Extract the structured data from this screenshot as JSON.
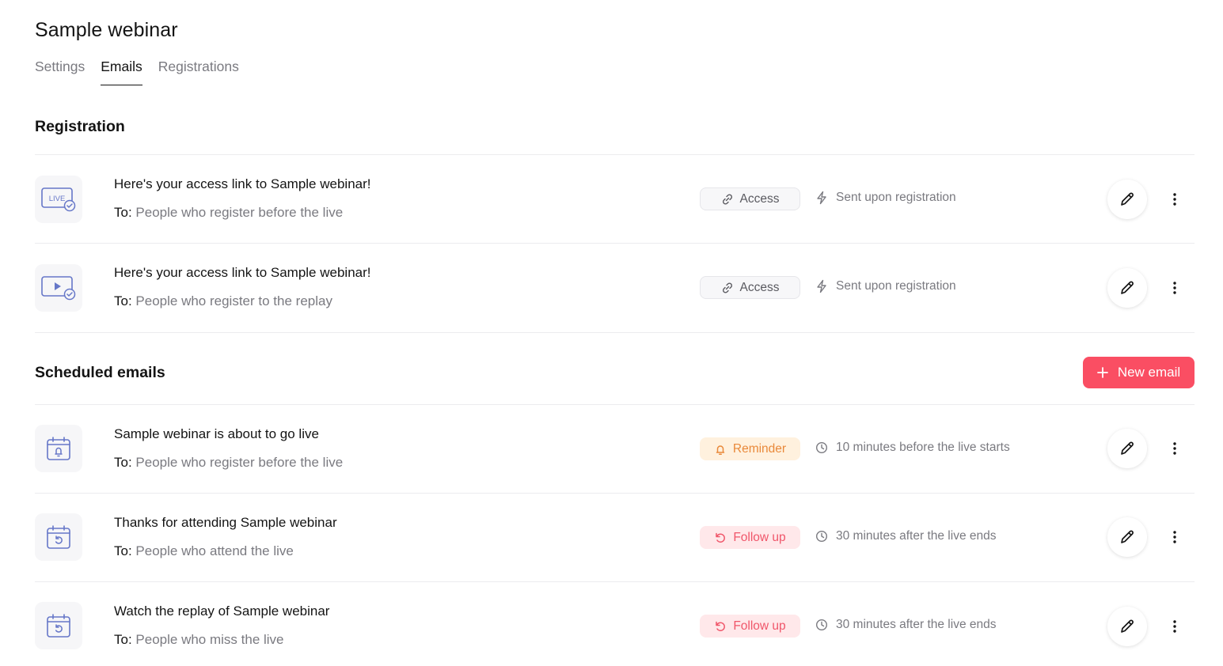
{
  "page": {
    "title": "Sample webinar"
  },
  "tabs": [
    {
      "label": "Settings"
    },
    {
      "label": "Emails"
    },
    {
      "label": "Registrations"
    }
  ],
  "active_tab": "Emails",
  "registration": {
    "title": "Registration",
    "emails": [
      {
        "icon": "live-icon",
        "icon_text": "LIVE",
        "subject": "Here's your access link to Sample webinar!",
        "to_label": "To:",
        "recipients": "People who register before the live",
        "badge": "Access",
        "badge_icon": "link-icon",
        "trigger_icon": "lightning-icon",
        "trigger": "Sent upon registration"
      },
      {
        "icon": "replay-video-icon",
        "subject": "Here's your access link to Sample webinar!",
        "to_label": "To:",
        "recipients": "People who register to the replay",
        "badge": "Access",
        "badge_icon": "link-icon",
        "trigger_icon": "lightning-icon",
        "trigger": "Sent upon registration"
      }
    ]
  },
  "scheduled": {
    "title": "Scheduled emails",
    "new_button": "New email",
    "emails": [
      {
        "icon": "calendar-bell-icon",
        "subject": "Sample webinar is about to go live",
        "to_label": "To:",
        "recipients": "People who register before the live",
        "badge": "Reminder",
        "badge_icon": "bell-icon",
        "trigger_icon": "clock-icon",
        "trigger": "10 minutes before the live starts"
      },
      {
        "icon": "calendar-undo-icon",
        "subject": "Thanks for attending Sample webinar",
        "to_label": "To:",
        "recipients": "People who attend the live",
        "badge": "Follow up",
        "badge_icon": "undo-icon",
        "trigger_icon": "clock-icon",
        "trigger": "30 minutes after the live ends"
      },
      {
        "icon": "calendar-undo-icon",
        "subject": "Watch the replay of Sample webinar",
        "to_label": "To:",
        "recipients": "People who miss the live",
        "badge": "Follow up",
        "badge_icon": "undo-icon",
        "trigger_icon": "clock-icon",
        "trigger": "30 minutes after the live ends"
      }
    ]
  },
  "colors": {
    "primary": "#fa4e63",
    "icon_accent": "#6677c8",
    "reminder_bg": "#fff1de",
    "reminder_text": "#e9893a",
    "followup_bg": "#ffe8ea",
    "followup_text": "#f0566a"
  }
}
